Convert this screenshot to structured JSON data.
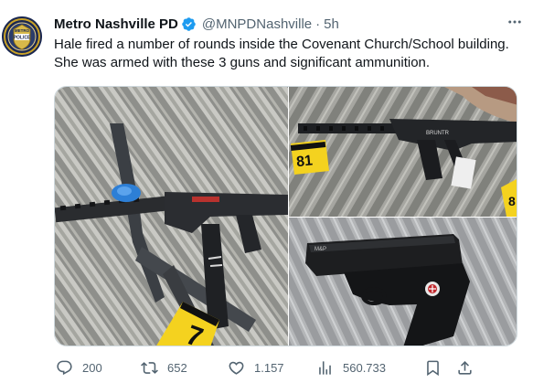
{
  "tweet": {
    "author_name": "Metro Nashville PD",
    "handle": "@MNPDNashville",
    "separator": "·",
    "time": "5h",
    "text": "Hale fired a number of rounds inside the Covenant Church/School building. She was armed with these 3 guns and significant ammunition.",
    "avatar_text_top": "METRO",
    "avatar_text_mid": "POLICE",
    "verified_color": "#1d9bf0"
  },
  "media": {
    "evidence_markers": {
      "left": "7",
      "top_right": "81",
      "top_right_edge": "8"
    }
  },
  "actions": {
    "reply_count": "200",
    "retweet_count": "652",
    "like_count": "1.157",
    "views_count": "560.733"
  },
  "icons": {
    "more": "more-dots-icon",
    "reply": "reply-icon",
    "retweet": "retweet-icon",
    "like": "heart-icon",
    "views": "views-bar-chart-icon",
    "bookmark": "bookmark-icon",
    "share": "share-icon",
    "verified": "verified-badge-icon"
  }
}
